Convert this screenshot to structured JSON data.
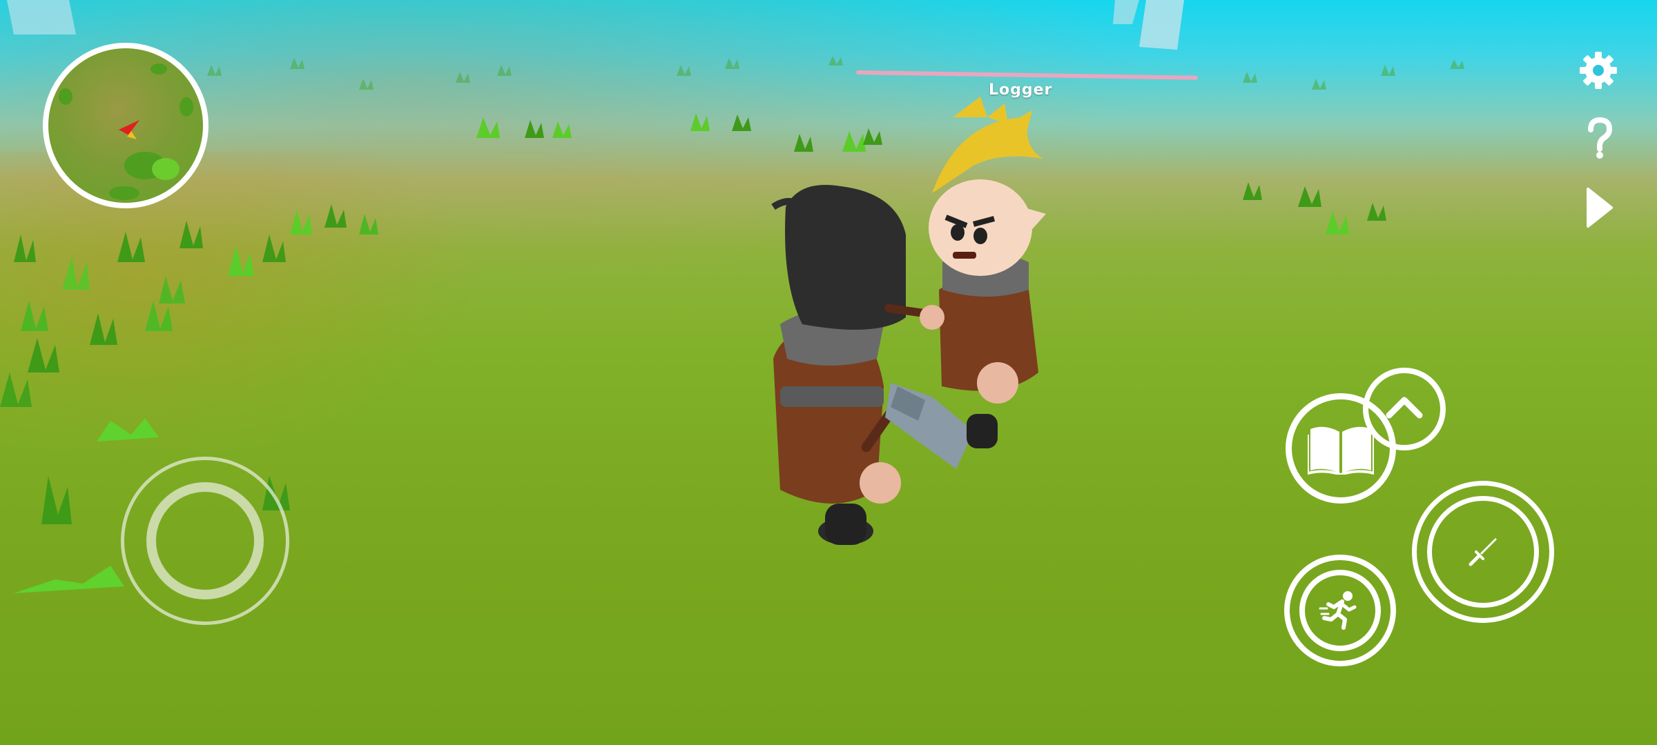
{
  "game": {
    "enemy": {
      "name": "Logger",
      "health_fraction": 1.0
    }
  },
  "hud": {
    "top_right": [
      {
        "name": "settings",
        "icon": "gear-icon"
      },
      {
        "name": "help",
        "icon": "question-mark-icon"
      },
      {
        "name": "play",
        "icon": "play-icon"
      }
    ],
    "action_buttons": [
      {
        "name": "book",
        "icon": "open-book-icon"
      },
      {
        "name": "jump",
        "icon": "chevron-up-icon"
      },
      {
        "name": "attack",
        "icon": "sword-icon"
      },
      {
        "name": "sprint",
        "icon": "running-person-icon"
      }
    ],
    "minimap": {
      "player_marker": "red-arrow-icon"
    },
    "joystick": {
      "icon": "movement-joystick"
    }
  },
  "colors": {
    "sky": "#17d6ee",
    "grass": "#7aa820",
    "ui_white": "#ffffff",
    "enemy_bar": "#e9a6c0"
  }
}
